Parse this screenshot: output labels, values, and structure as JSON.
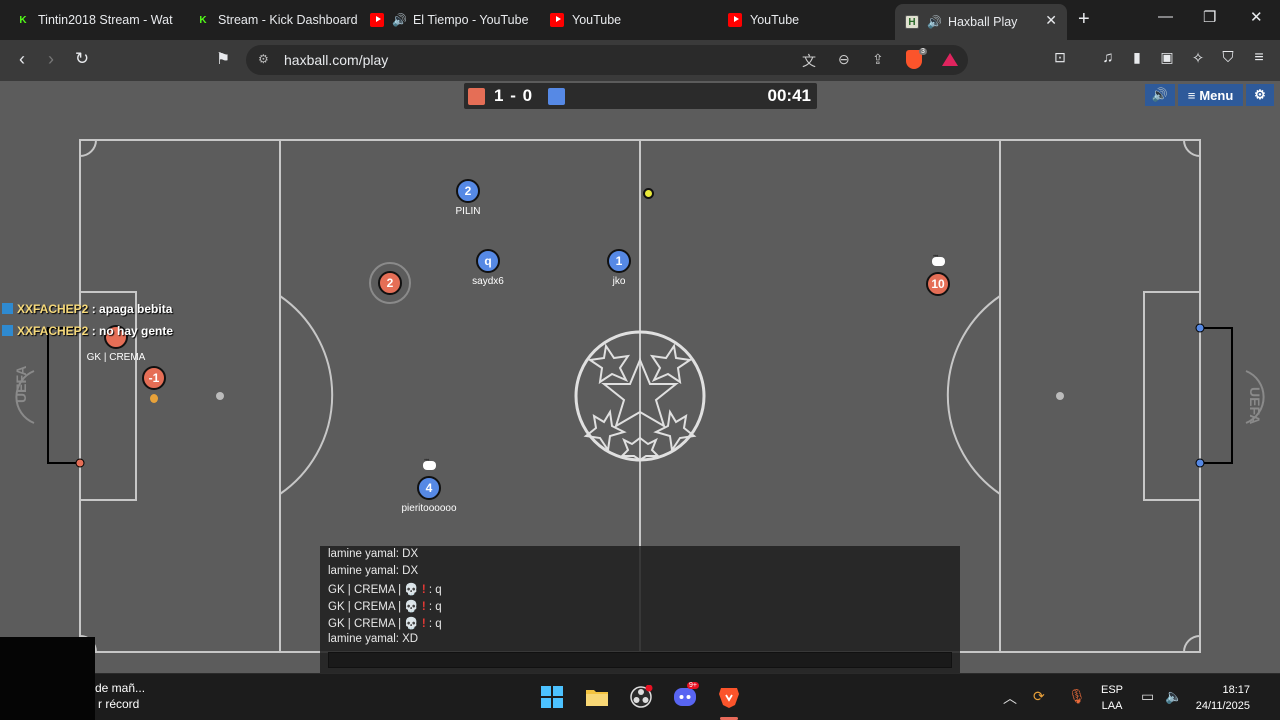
{
  "browser": {
    "tabs": [
      {
        "title": "Tintin2018 Stream - Wat",
        "icon": "kick-icon"
      },
      {
        "title": "Stream - Kick Dashboard",
        "icon": "kick-icon"
      },
      {
        "title": "El Tiempo - YouTube",
        "icon": "youtube-icon",
        "audio": true
      },
      {
        "title": "YouTube",
        "icon": "youtube-icon"
      },
      {
        "title": "YouTube",
        "icon": "youtube-icon"
      },
      {
        "title": "Haxball Play",
        "icon": "haxball-icon",
        "audio": true,
        "active": true
      }
    ],
    "url": "haxball.com/play",
    "shields_badge": "3"
  },
  "game": {
    "score_red": "1",
    "score_sep": "-",
    "score_blue": "0",
    "timer": "00:41",
    "menu_label": "Menu",
    "colors": {
      "red": "#e56e56",
      "blue": "#5689e5",
      "field": "#5c5c5c"
    },
    "players": [
      {
        "number": "2",
        "name": "PILIN",
        "team": "blue"
      },
      {
        "number": "q",
        "name": "saydx6",
        "team": "blue"
      },
      {
        "number": "1",
        "name": "jko",
        "team": "blue"
      },
      {
        "number": "4",
        "name": "pieritoooooo",
        "team": "blue"
      },
      {
        "number": "2",
        "name": "",
        "team": "red"
      },
      {
        "number": "10",
        "name": "",
        "team": "red"
      },
      {
        "number": "-1",
        "name": "",
        "team": "red"
      },
      {
        "number": "",
        "name": "GK | CREMA",
        "team": "red"
      }
    ],
    "overlay_chat": [
      {
        "name": "XXFACHEP2",
        "text": " : apaga bebita"
      },
      {
        "name": "XXFACHEP2",
        "text": " : no hay gente"
      }
    ],
    "chat_log": [
      {
        "text": "lamine yamal: DX"
      },
      {
        "text": "lamine yamal: DX"
      },
      {
        "text": "GK | CREMA |",
        "skull": true,
        "tail": " : q"
      },
      {
        "text": "GK | CREMA |",
        "skull": true,
        "tail": " : q"
      },
      {
        "text": "GK | CREMA |",
        "skull": true,
        "tail": " : q"
      },
      {
        "text": "lamine yamal: XD"
      }
    ]
  },
  "taskbar": {
    "widget_line1": "de mañ...",
    "widget_line2": "r récord",
    "discord_badge": "9+",
    "lang_line1": "ESP",
    "lang_line2": "LAA",
    "time": "18:17",
    "date": "24/11/2025"
  }
}
